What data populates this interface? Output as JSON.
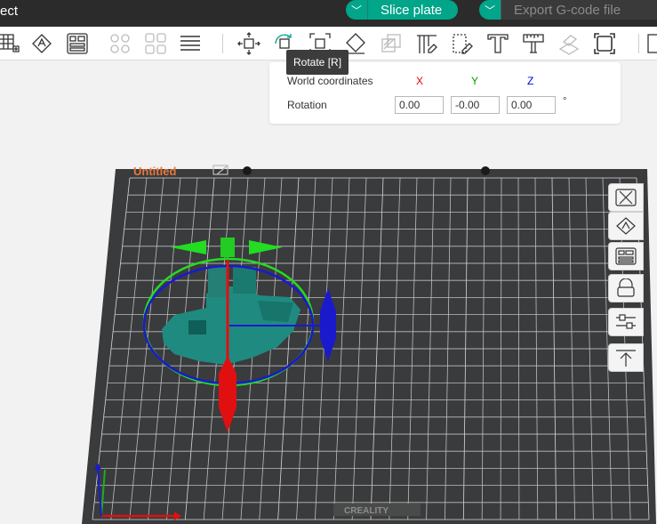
{
  "window": {
    "title": "ect"
  },
  "topbar": {
    "slice_label": "Slice plate",
    "export_label": "Export G-code file",
    "dropdown_glyph": "﹀"
  },
  "toolbar": {
    "tooltip": "Rotate [R]",
    "icons": [
      "plate-grid-icon",
      "auto-orient-icon",
      "arrange-icon",
      "split-objects-icon",
      "split-parts-icon",
      "layers-icon",
      "move-icon",
      "rotate-icon",
      "scale-icon",
      "lay-on-face-icon",
      "cut-icon",
      "support-paint-icon",
      "seam-paint-icon",
      "text-icon",
      "measure-icon",
      "assembly-icon",
      "fit-view-icon"
    ]
  },
  "rotation_panel": {
    "world_coordinates_label": "World coordinates",
    "rotation_label": "Rotation",
    "axes": [
      "X",
      "Y",
      "Z"
    ],
    "axis_colors": {
      "x": "#e60000",
      "y": "#00a000",
      "z": "#0000e0"
    },
    "values": {
      "x": "0.00",
      "y": "-0.00",
      "z": "0.00"
    },
    "unit": "°"
  },
  "plate": {
    "name": "Untitled",
    "brand": "CREALITY"
  },
  "colors": {
    "accent": "#00a58a",
    "plate_name": "#e8773a",
    "model": "#1f8a80"
  }
}
